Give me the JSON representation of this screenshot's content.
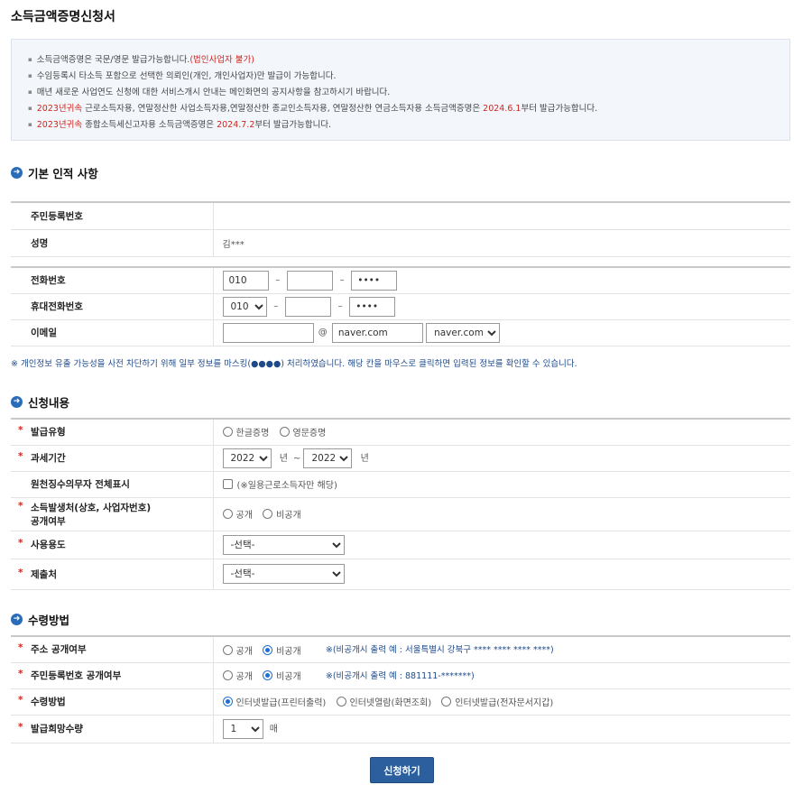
{
  "page": {
    "title": "소득금액증명신청서"
  },
  "notice": {
    "lines": [
      {
        "text": "소득금액증명은 국문/영문 발급가능합니다.",
        "highlight": "(법인사업자 불가)",
        "tail": ""
      },
      {
        "text": "수임등록시 타소득 포함으로 선택한 의뢰인(개인, 개인사업자)만 발급이 가능합니다.",
        "highlight": "",
        "tail": ""
      },
      {
        "text": "매년 새로운 사업연도 신청에 대한 서비스개시 안내는 메인화면의 공지사항을 참고하시기 바랍니다.",
        "highlight": "",
        "tail": ""
      },
      {
        "text": "",
        "highlight": "2023년귀속",
        "tail": " 근로소득자용, 연말정산한 사업소득자용,연말정산한 종교인소득자용, 연말정산한 연금소득자용 소득금액증명은 ",
        "highlight2": "2024.6.1",
        "tail2": "부터 발급가능합니다."
      },
      {
        "text": "",
        "highlight": "2023년귀속",
        "tail": " 종합소득세신고자용 소득금액증명은 ",
        "highlight2": "2024.7.2",
        "tail2": "부터 발급가능합니다."
      }
    ]
  },
  "section_basic": {
    "title": "기본 인적 사항",
    "rrn_label": "주민등록번호",
    "rrn_value": "",
    "name_label": "성명",
    "name_value": "김***",
    "phone_label": "전화번호",
    "phone_1": "010",
    "phone_2": "",
    "phone_3": "••••",
    "mobile_label": "휴대전화번호",
    "mobile_1": "010",
    "mobile_2": "",
    "mobile_3": "••••",
    "email_label": "이메일",
    "email_id": "",
    "email_at": "@",
    "email_domain": "naver.com",
    "email_domain_select": "naver.com"
  },
  "mask_note": "※ 개인정보 유출 가능성을 사전 차단하기 위해 일부 정보를 마스킹(●●●●) 처리하였습니다. 해당 칸을 마우스로 클릭하면 입력된 정보를 확인할 수 있습니다.",
  "section_request": {
    "title": "신청내용",
    "issue_type_label": "발급유형",
    "issue_type_options": [
      "한글증명",
      "영문증명"
    ],
    "period_label": "과세기간",
    "period_from": "2022",
    "period_unit": "년",
    "period_sep": "~",
    "period_to": "2022",
    "withholding_label": "원천징수의무자 전체표시",
    "withholding_note": "(※일용근로소득자만 해당)",
    "disclosure_label_1": "소득발생처(상호, 사업자번호)",
    "disclosure_label_2": "공개여부",
    "disclosure_options": [
      "공개",
      "비공개"
    ],
    "purpose_label": "사용용도",
    "purpose_value": "-선택-",
    "submit_to_label": "제출처",
    "submit_to_value": "-선택-"
  },
  "section_receive": {
    "title": "수령방법",
    "address_label": "주소 공개여부",
    "address_options": [
      "공개",
      "비공개"
    ],
    "address_hint": "※(비공개시 출력 예 : 서울특별시 강북구 **** **** **** ****)",
    "rrn_disclose_label": "주민등록번호 공개여부",
    "rrn_disclose_options": [
      "공개",
      "비공개"
    ],
    "rrn_disclose_hint": "※(비공개시 출력 예 : 881111-*******)",
    "method_label": "수령방법",
    "method_options": [
      "인터넷발급(프린터출력)",
      "인터넷열람(화면조회)",
      "인터넷발급(전자문서지갑)"
    ],
    "copies_label": "발급희망수량",
    "copies_value": "1",
    "copies_unit": "매"
  },
  "submit_label": "신청하기",
  "colors": {
    "accent": "#2b5f9e",
    "required": "#d0261e",
    "notice_bg": "#f3f6fb"
  }
}
